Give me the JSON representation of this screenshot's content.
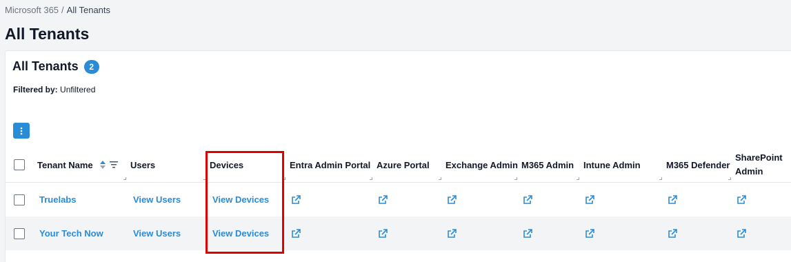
{
  "breadcrumb": {
    "parent": "Microsoft 365",
    "separator": "/",
    "current": "All Tenants"
  },
  "page_title": "All Tenants",
  "card": {
    "title": "All Tenants",
    "count": "2",
    "filter_label": "Filtered by:",
    "filter_value": "Unfiltered"
  },
  "table": {
    "columns": {
      "tenant_name": "Tenant Name",
      "users": "Users",
      "devices": "Devices",
      "entra": "Entra Admin Portal",
      "azure": "Azure Portal",
      "exchange": "Exchange Admin",
      "m365admin": "M365 Admin",
      "intune": "Intune Admin",
      "defender": "M365 Defender",
      "sharepoint_1": "SharePoint",
      "sharepoint_2": "Admin"
    },
    "rows": [
      {
        "tenant": "Truelabs",
        "users": "View Users",
        "devices": "View Devices"
      },
      {
        "tenant": "Your Tech Now",
        "users": "View Users",
        "devices": "View Devices"
      }
    ]
  },
  "icons": {
    "external_link": "external-link-icon",
    "sort": "sort-icon",
    "filter": "filter-icon",
    "kebab": "kebab-menu-icon"
  },
  "colors": {
    "accent": "#2a8bd6",
    "highlight": "#e00000"
  }
}
